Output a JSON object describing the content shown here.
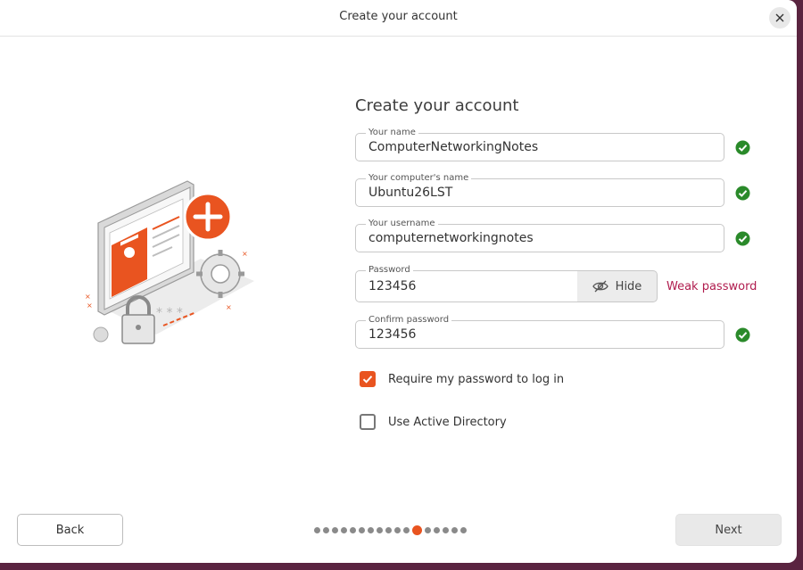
{
  "window": {
    "title": "Create your account"
  },
  "form": {
    "heading": "Create your account",
    "fields": [
      {
        "label": "Your name",
        "value": "ComputerNetworkingNotes",
        "valid": true
      },
      {
        "label": "Your computer's name",
        "value": "Ubuntu26LST",
        "valid": true
      },
      {
        "label": "Your username",
        "value": "computernetworkingnotes",
        "valid": true
      },
      {
        "label": "Password",
        "value": "123456",
        "strength": "Weak password"
      },
      {
        "label": "Confirm password",
        "value": "123456",
        "valid": true
      }
    ],
    "hide_label": "Hide",
    "options": [
      {
        "label": "Require my password to log in",
        "checked": true
      },
      {
        "label": "Use Active Directory",
        "checked": false
      }
    ]
  },
  "footer": {
    "back_label": "Back",
    "next_label": "Next",
    "steps_total": 17,
    "current_step": 12
  },
  "colors": {
    "accent": "#e95420",
    "valid": "#2a8a2a",
    "warning": "#b01c4e"
  }
}
